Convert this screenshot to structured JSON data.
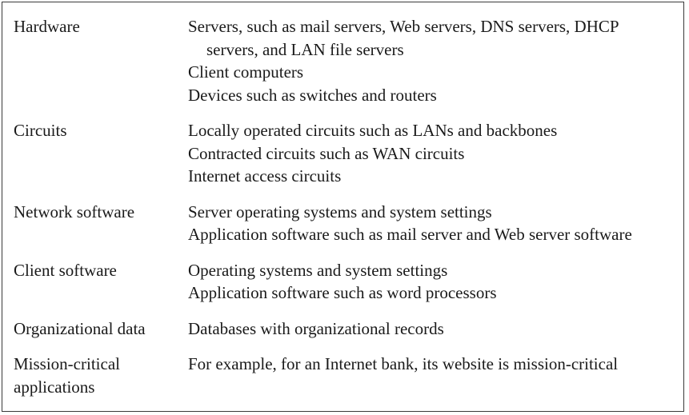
{
  "rows": [
    {
      "category": "Hardware",
      "items": [
        "Servers, such as mail servers, Web servers, DNS servers, DHCP",
        "servers, and LAN file servers",
        "Client computers",
        "Devices such as switches and routers"
      ]
    },
    {
      "category": "Circuits",
      "items": [
        "Locally operated circuits such as LANs and backbones",
        "Contracted circuits such as WAN circuits",
        "Internet access circuits"
      ]
    },
    {
      "category": "Network software",
      "items": [
        "Server operating systems and system settings",
        "Application software such as mail server and Web server software"
      ]
    },
    {
      "category": "Client software",
      "items": [
        "Operating systems and system settings",
        "Application software such as word processors"
      ]
    },
    {
      "category": "Organizational data",
      "items": [
        "Databases with organizational records"
      ]
    },
    {
      "category_lines": [
        "Mission-critical",
        "applications"
      ],
      "items": [
        "For example, for an Internet bank, its website is mission-critical"
      ]
    }
  ]
}
